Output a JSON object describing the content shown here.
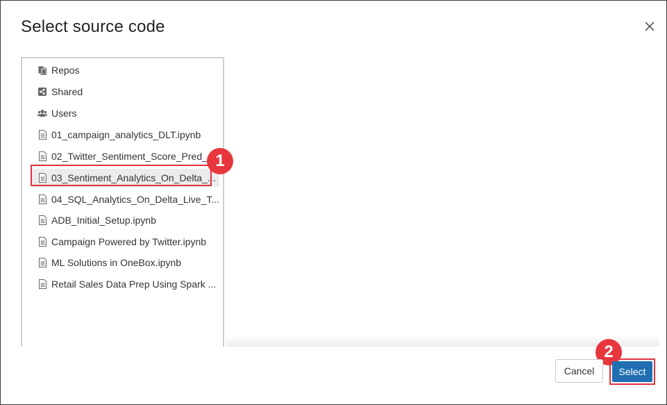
{
  "dialog": {
    "title": "Select source code",
    "close_icon": "close-icon"
  },
  "tree": {
    "items": [
      {
        "label": "Repos",
        "icon": "repos-icon",
        "selected": false
      },
      {
        "label": "Shared",
        "icon": "share-icon",
        "selected": false
      },
      {
        "label": "Users",
        "icon": "users-icon",
        "selected": false
      },
      {
        "label": "01_campaign_analytics_DLT.ipynb",
        "icon": "notebook-icon",
        "selected": false
      },
      {
        "label": "02_Twitter_Sentiment_Score_Pred_...",
        "icon": "notebook-icon",
        "selected": false
      },
      {
        "label": "03_Sentiment_Analytics_On_Delta_...",
        "icon": "notebook-icon",
        "selected": true
      },
      {
        "label": "04_SQL_Analytics_On_Delta_Live_T...",
        "icon": "notebook-icon",
        "selected": false
      },
      {
        "label": "ADB_Initial_Setup.ipynb",
        "icon": "notebook-icon",
        "selected": false
      },
      {
        "label": "Campaign Powered by Twitter.ipynb",
        "icon": "notebook-icon",
        "selected": false
      },
      {
        "label": "ML Solutions in OneBox.ipynb",
        "icon": "notebook-icon",
        "selected": false
      },
      {
        "label": "Retail Sales Data Prep Using Spark ...",
        "icon": "notebook-icon",
        "selected": false
      }
    ]
  },
  "annotations": {
    "step1": "1",
    "step2": "2",
    "highlight_color": "#e0313e"
  },
  "footer": {
    "cancel_label": "Cancel",
    "select_label": "Select",
    "primary_color": "#1f6fb2"
  }
}
